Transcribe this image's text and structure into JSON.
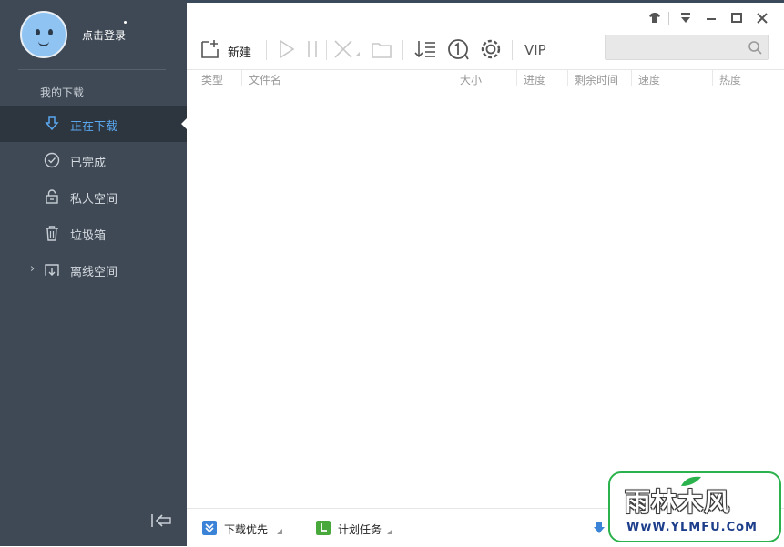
{
  "sidebar": {
    "login_text": "点击登录",
    "section_label": "我的下载",
    "items": [
      {
        "label": "正在下载",
        "icon": "download-arrow-icon",
        "active": true
      },
      {
        "label": "已完成",
        "icon": "check-circle-icon",
        "active": false
      },
      {
        "label": "私人空间",
        "icon": "lock-icon",
        "active": false
      },
      {
        "label": "垃圾箱",
        "icon": "trash-icon",
        "active": false
      },
      {
        "label": "离线空间",
        "icon": "cloud-download-icon",
        "active": false
      }
    ],
    "accent_color": "#5aa8f0",
    "bg_color": "#3f4955"
  },
  "toolbar": {
    "new_label": "新建",
    "vip_label": "VIP",
    "search_placeholder": ""
  },
  "table": {
    "columns": [
      "类型",
      "文件名",
      "大小",
      "进度",
      "剩余时间",
      "速度",
      "热度"
    ]
  },
  "status": {
    "priority_label": "下载优先",
    "schedule_label": "计划任务"
  },
  "watermark": {
    "title": "雨林木风",
    "url": "WwW.YLMFU.CoM"
  }
}
